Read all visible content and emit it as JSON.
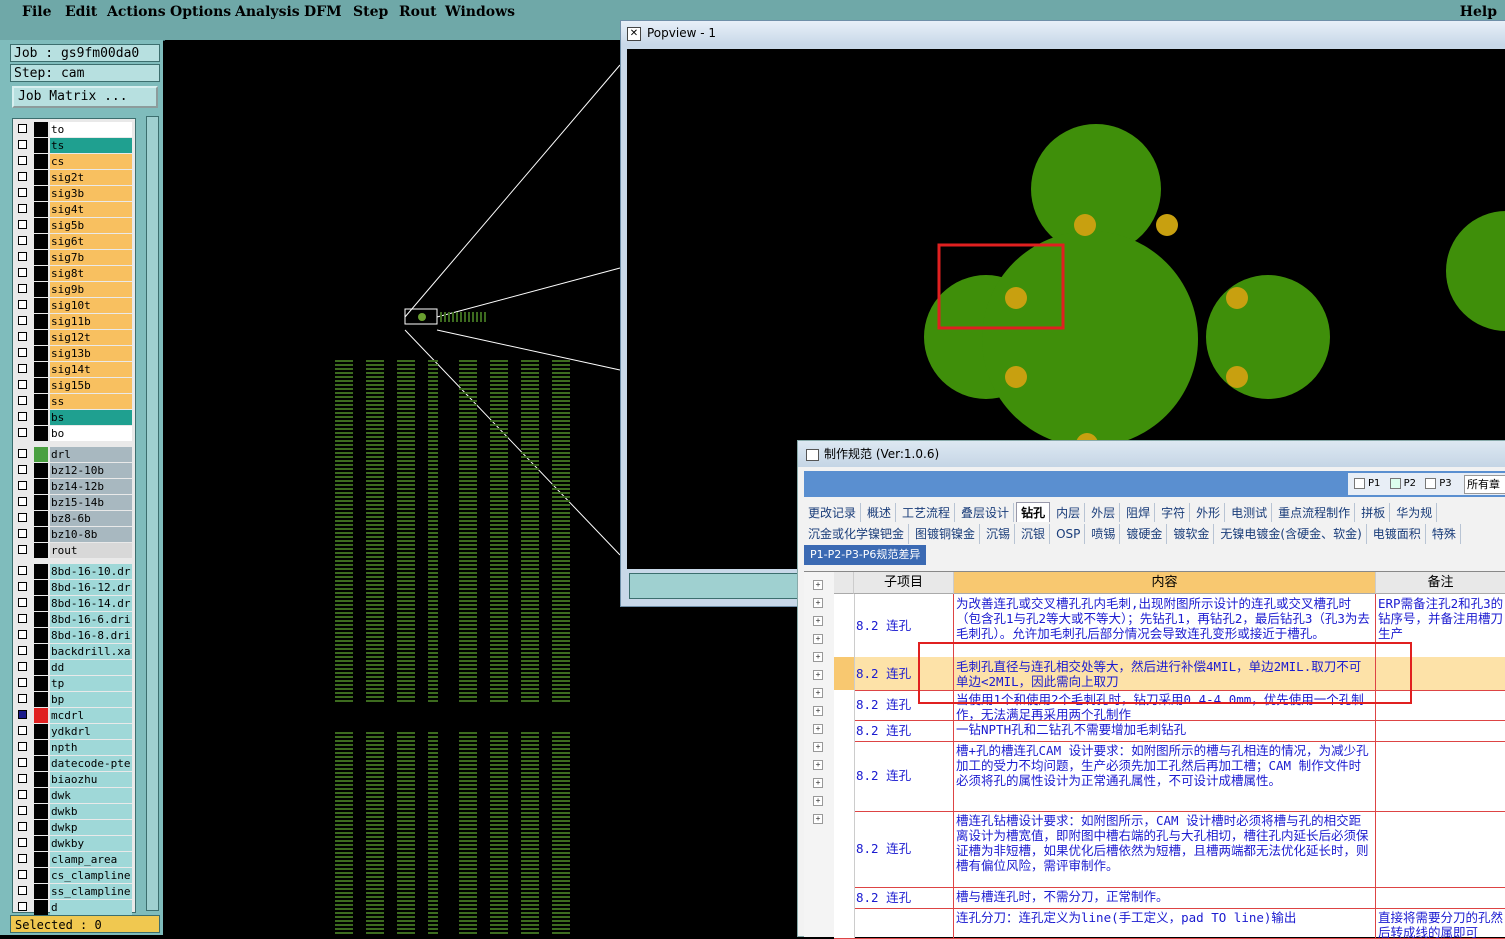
{
  "menubar": {
    "items": [
      "File",
      "Edit",
      "Actions",
      "Options",
      "Analysis",
      "DFM",
      "Step",
      "Rout",
      "Windows"
    ],
    "help": "Help"
  },
  "job": {
    "job_label": "Job : gs9fm00da0",
    "step_label": "Step: cam",
    "matrix_button": "Job Matrix ...",
    "selected": "Selected : 0"
  },
  "layers": [
    {
      "name": "to",
      "color": "#ffffff"
    },
    {
      "name": "ts",
      "color": "#1fa090"
    },
    {
      "name": "cs",
      "color": "#f8c060"
    },
    {
      "name": "sig2t",
      "color": "#f8c060"
    },
    {
      "name": "sig3b",
      "color": "#f8c060"
    },
    {
      "name": "sig4t",
      "color": "#f8c060"
    },
    {
      "name": "sig5b",
      "color": "#f8c060"
    },
    {
      "name": "sig6t",
      "color": "#f8c060"
    },
    {
      "name": "sig7b",
      "color": "#f8c060"
    },
    {
      "name": "sig8t",
      "color": "#f8c060"
    },
    {
      "name": "sig9b",
      "color": "#f8c060"
    },
    {
      "name": "sig10t",
      "color": "#f8c060"
    },
    {
      "name": "sig11b",
      "color": "#f8c060"
    },
    {
      "name": "sig12t",
      "color": "#f8c060"
    },
    {
      "name": "sig13b",
      "color": "#f8c060"
    },
    {
      "name": "sig14t",
      "color": "#f8c060"
    },
    {
      "name": "sig15b",
      "color": "#f8c060"
    },
    {
      "name": "ss",
      "color": "#f8c060"
    },
    {
      "name": "bs",
      "color": "#1fa090"
    },
    {
      "name": "bo",
      "color": "#ffffff"
    },
    {
      "name": "drl",
      "color": "#a8b8c0"
    },
    {
      "name": "bz12-10b",
      "color": "#a8b8c0"
    },
    {
      "name": "bz14-12b",
      "color": "#a8b8c0"
    },
    {
      "name": "bz15-14b",
      "color": "#a8b8c0"
    },
    {
      "name": "bz8-6b",
      "color": "#a8b8c0"
    },
    {
      "name": "bz10-8b",
      "color": "#a8b8c0"
    },
    {
      "name": "rout",
      "color": "#d8d8d8"
    },
    {
      "name": "8bd-16-10.dr",
      "color": "#9fd8d8"
    },
    {
      "name": "8bd-16-12.dr",
      "color": "#9fd8d8"
    },
    {
      "name": "8bd-16-14.dr",
      "color": "#9fd8d8"
    },
    {
      "name": "8bd-16-6.dri",
      "color": "#9fd8d8"
    },
    {
      "name": "8bd-16-8.dri",
      "color": "#9fd8d8"
    },
    {
      "name": "backdrill.xa",
      "color": "#9fd8d8"
    },
    {
      "name": "dd",
      "color": "#9fd8d8"
    },
    {
      "name": "tp",
      "color": "#9fd8d8"
    },
    {
      "name": "bp",
      "color": "#9fd8d8"
    },
    {
      "name": "mcdrl",
      "color": "#9fd8d8"
    },
    {
      "name": "ydkdrl",
      "color": "#9fd8d8"
    },
    {
      "name": "npth",
      "color": "#9fd8d8"
    },
    {
      "name": "datecode-pte",
      "color": "#9fd8d8"
    },
    {
      "name": "biaozhu",
      "color": "#9fd8d8"
    },
    {
      "name": "dwk",
      "color": "#9fd8d8"
    },
    {
      "name": "dwkb",
      "color": "#9fd8d8"
    },
    {
      "name": "dwkp",
      "color": "#9fd8d8"
    },
    {
      "name": "dwkby",
      "color": "#9fd8d8"
    },
    {
      "name": "clamp_area",
      "color": "#9fd8d8"
    },
    {
      "name": "cs_clampline",
      "color": "#9fd8d8"
    },
    {
      "name": "ss_clampline",
      "color": "#9fd8d8"
    },
    {
      "name": "d",
      "color": "#9fd8d8"
    }
  ],
  "popview": {
    "title": "Popview - 1"
  },
  "spec": {
    "title": "制作规范 (Ver:1.0.6)",
    "options": [
      "P1",
      "P2",
      "P3"
    ],
    "all_select": "所有章",
    "tabs_row1": [
      "更改记录",
      "概述",
      "工艺流程",
      "叠层设计",
      "钻孔",
      "内层",
      "外层",
      "阻焊",
      "字符",
      "外形",
      "电测试",
      "重点流程制作",
      "拼板",
      "华为规"
    ],
    "tabs_row2": [
      "沉金或化学镍钯金",
      "图镀铜镍金",
      "沉锡",
      "沉银",
      "OSP",
      "喷锡",
      "镀硬金",
      "镀软金",
      "无镍电镀金(含硬金、软金)",
      "电镀面积",
      "特殊"
    ],
    "tab3": "P1-P2-P3-P6规范差异",
    "headers": {
      "sub": "子项目",
      "content": "内容",
      "note": "备注"
    },
    "rows": [
      {
        "sub": "8.2 连孔",
        "content": "为改善连孔或交叉槽孔孔内毛刺,出现附图所示设计的连孔或交叉槽孔时（包含孔1与孔2等大或不等大）；先钻孔1，再钻孔2，最后钻孔3（孔3为去毛刺孔）。允许加毛刺孔后部分情况会导致连孔变形或接近于槽孔。",
        "note": "ERP需备注孔2和孔3的钻序号，并备注用槽刀生产"
      },
      {
        "sub": "8.2 连孔",
        "content": "毛刺孔直径与连孔相交处等大，然后进行补偿4MIL，单边2MIL.取刀不可单边<2MIL，因此需向上取刀",
        "note": ""
      },
      {
        "sub": "8.2 连孔",
        "content": "当使用1个和使用2个毛刺孔时，钻刀采用0.4-4.0mm，优先使用一个孔制作，无法满足再采用两个孔制作",
        "note": ""
      },
      {
        "sub": "8.2 连孔",
        "content": "一钻NPTH孔和二钻孔不需要增加毛刺钻孔",
        "note": ""
      },
      {
        "sub": "8.2 连孔",
        "content": "槽+孔的槽连孔CAM 设计要求：如附图所示的槽与孔相连的情况，为减少孔加工的受力不均问题，生产必须先加工孔然后再加工槽；CAM 制作文件时必须将孔的属性设计为正常通孔属性，不可设计成槽属性。",
        "note": ""
      },
      {
        "sub": "8.2 连孔",
        "content": "槽连孔钻槽设计要求：如附图所示，CAM 设计槽时必须将槽与孔的相交距离设计为槽宽值，即附图中槽右端的孔与大孔相切，槽往孔内延长后必须保证槽为非短槽，如果优化后槽依然为短槽，且槽两端都无法优化延长时，则槽有偏位风险，需评审制作。",
        "note": ""
      },
      {
        "sub": "8.2 连孔",
        "content": "槽与槽连孔时，不需分刀，正常制作。",
        "note": ""
      },
      {
        "sub": "",
        "content": "连孔分刀：连孔定义为line(手工定义，pad TO line)输出",
        "note": "直接将需要分刀的孔然后转成线的属即可"
      }
    ]
  }
}
